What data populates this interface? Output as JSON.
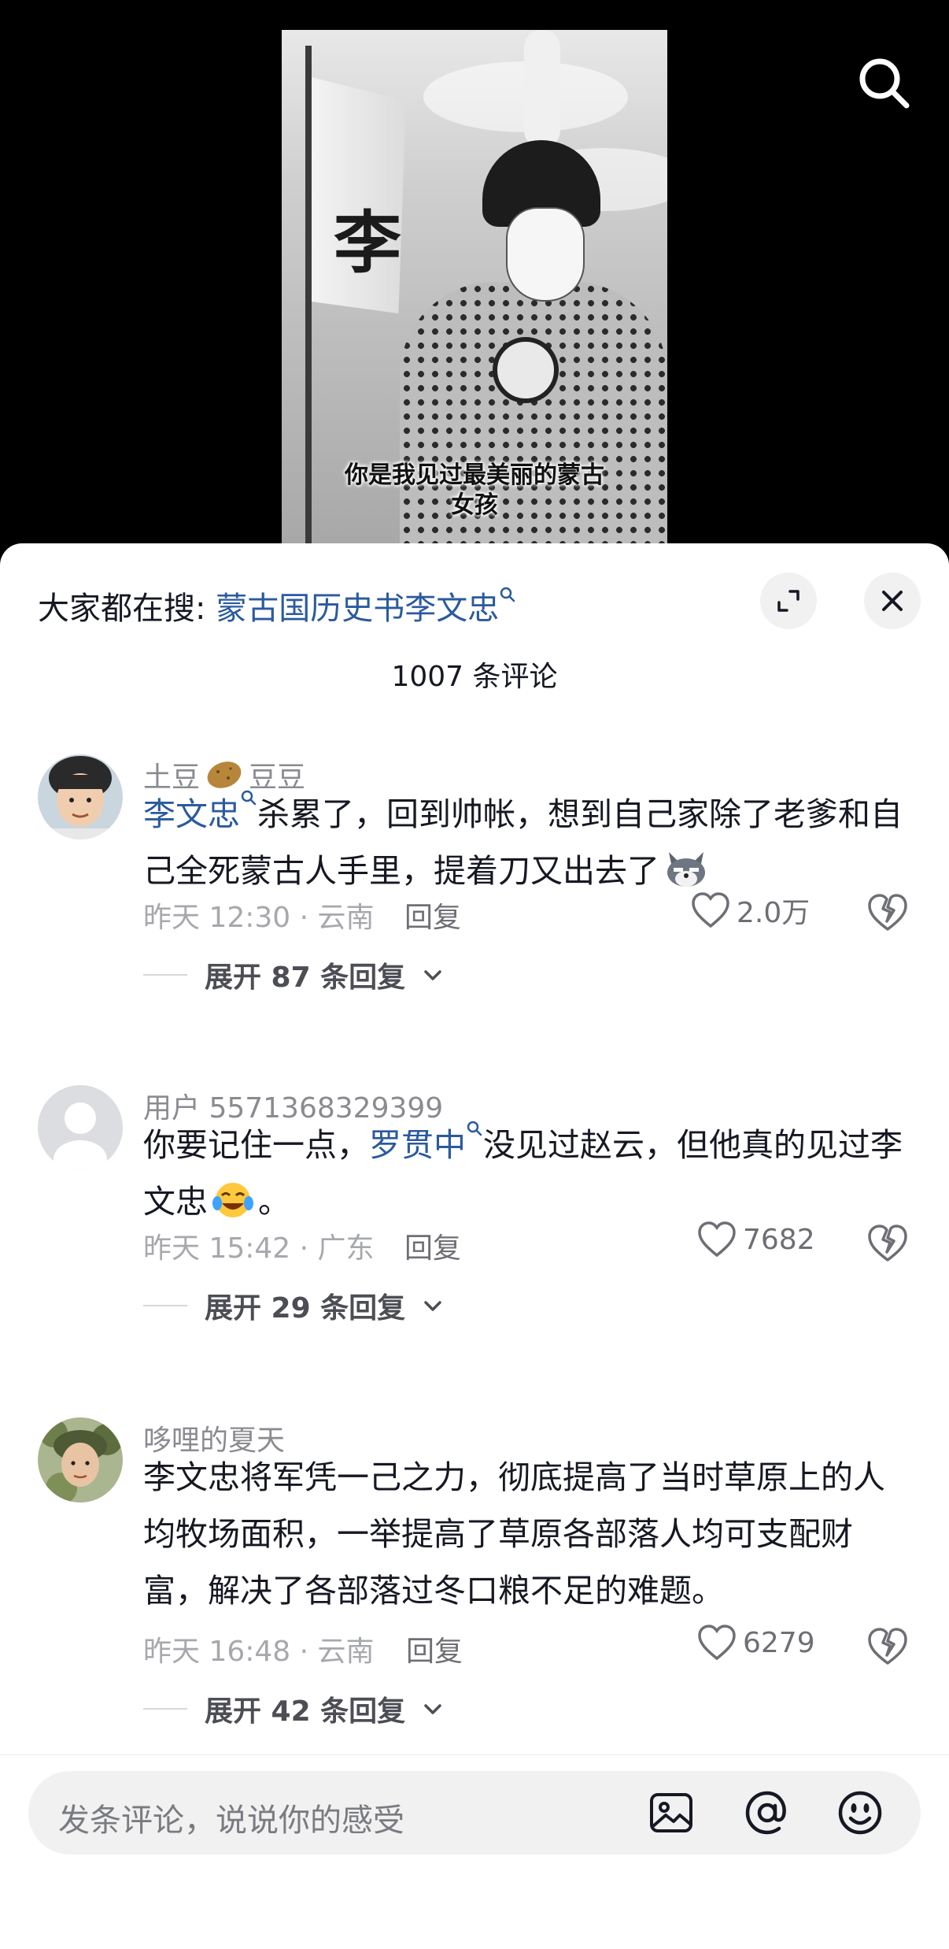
{
  "video": {
    "banner_char": "李",
    "subtitle_line1": "你是我见过最美丽的蒙古",
    "subtitle_line2": "女孩"
  },
  "sheet": {
    "hot_search_prefix": "大家都在搜:",
    "hot_search_term": "蒙古国历史书李文忠",
    "comment_count": "1007 条评论"
  },
  "comments": [
    {
      "author": "土豆",
      "author_suffix": "豆豆",
      "author_emoji": "potato-emoji",
      "tag": "李文忠",
      "text": "杀累了，回到帅帐，想到自己家除了老爹和自己全死蒙古人手里，提着刀又出去了",
      "emoji": "wolf-emoji",
      "time": "昨天 12:30 · 云南",
      "reply_label": "回复",
      "likes": "2.0万",
      "expand": "展开 87 条回复"
    },
    {
      "author": "用户 5571368329399",
      "text_before": "你要记住一点，",
      "tag": "罗贯中",
      "text_after": "没见过赵云，但他真的见过李文忠",
      "text_end": "。",
      "emoji": "crying-laughing-emoji",
      "time": "昨天 15:42 · 广东",
      "reply_label": "回复",
      "likes": "7682",
      "expand": "展开 29 条回复"
    },
    {
      "author": "哆哩的夏天",
      "text": "李文忠将军凭一己之力，彻底提高了当时草原上的人均牧场面积，一举提高了草原各部落人均可支配财富，解决了各部落过冬口粮不足的难题。",
      "time": "昨天 16:48 · 云南",
      "reply_label": "回复",
      "likes": "6279",
      "expand": "展开 42 条回复"
    }
  ],
  "input": {
    "placeholder": "发条评论，说说你的感受"
  },
  "colors": {
    "link": "#2b5a9e",
    "muted": "#a7a8ad",
    "text": "#161823",
    "input_bg": "#f1f1f2"
  }
}
